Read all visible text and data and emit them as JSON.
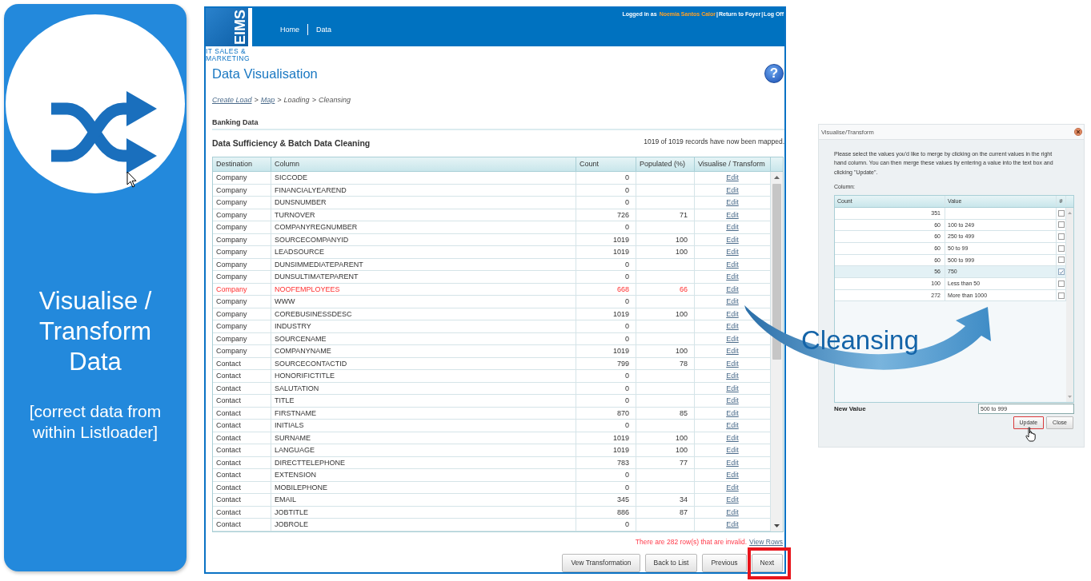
{
  "slide": {
    "title": "Visualise / Transform Data",
    "subtitle": "[correct data from within Listloader]"
  },
  "app": {
    "logo": {
      "mark": "EIMS",
      "tagline": "IT SALES & MARKETING"
    },
    "nav": [
      {
        "label": "Home"
      },
      {
        "label": "Data"
      }
    ],
    "user_bar": {
      "label": "Logged in as",
      "user": "Noemia Santos Calor",
      "separator": "|",
      "links": [
        "Return to Foyer",
        "Log Off"
      ]
    },
    "title": "Data Visualisation",
    "help": "?",
    "breadcrumb": {
      "separator": ">",
      "items": [
        {
          "label": "Create Load",
          "kind": "link"
        },
        {
          "label": "Map",
          "kind": "link"
        },
        {
          "label": "Loading",
          "kind": "text"
        },
        {
          "label": "Cleansing",
          "kind": "text"
        }
      ]
    },
    "section": "Banking Data",
    "table_title": "Data Sufficiency & Batch Data Cleaning",
    "mapped_status": "1019 of 1019 records have now been mapped.",
    "table": {
      "columns": [
        "Destination",
        "Column",
        "Count",
        "Populated (%)",
        "Visualise / Transform"
      ],
      "rows": [
        {
          "destination": "Company",
          "column": "SICCODE",
          "count": "0",
          "action": "Edit",
          "flagged": false
        },
        {
          "destination": "Company",
          "column": "FINANCIALYEAREND",
          "count": "0",
          "action": "Edit",
          "flagged": false
        },
        {
          "destination": "Company",
          "column": "DUNSNUMBER",
          "count": "0",
          "action": "Edit",
          "flagged": false
        },
        {
          "destination": "Company",
          "column": "TURNOVER",
          "count": "726",
          "populated": "71",
          "action": "Edit",
          "flagged": false
        },
        {
          "destination": "Company",
          "column": "COMPANYREGNUMBER",
          "count": "0",
          "action": "Edit",
          "flagged": false
        },
        {
          "destination": "Company",
          "column": "SOURCECOMPANYID",
          "count": "1019",
          "populated": "100",
          "action": "Edit",
          "flagged": false
        },
        {
          "destination": "Company",
          "column": "LEADSOURCE",
          "count": "1019",
          "populated": "100",
          "action": "Edit",
          "flagged": false
        },
        {
          "destination": "Company",
          "column": "DUNSIMMEDIATEPARENT",
          "count": "0",
          "action": "Edit",
          "flagged": false
        },
        {
          "destination": "Company",
          "column": "DUNSULTIMATEPARENT",
          "count": "0",
          "action": "Edit",
          "flagged": false
        },
        {
          "destination": "Company",
          "column": "NOOFEMPLOYEES",
          "count": "668",
          "populated": "66",
          "action": "Edit",
          "flagged": true
        },
        {
          "destination": "Company",
          "column": "WWW",
          "count": "0",
          "action": "Edit",
          "flagged": false
        },
        {
          "destination": "Company",
          "column": "COREBUSINESSDESC",
          "count": "1019",
          "populated": "100",
          "action": "Edit",
          "flagged": false
        },
        {
          "destination": "Company",
          "column": "INDUSTRY",
          "count": "0",
          "action": "Edit",
          "flagged": false
        },
        {
          "destination": "Company",
          "column": "SOURCENAME",
          "count": "0",
          "action": "Edit",
          "flagged": false
        },
        {
          "destination": "Company",
          "column": "COMPANYNAME",
          "count": "1019",
          "populated": "100",
          "action": "Edit",
          "flagged": false
        },
        {
          "destination": "Contact",
          "column": "SOURCECONTACTID",
          "count": "799",
          "populated": "78",
          "action": "Edit",
          "flagged": false
        },
        {
          "destination": "Contact",
          "column": "HONORIFICTITLE",
          "count": "0",
          "action": "Edit",
          "flagged": false
        },
        {
          "destination": "Contact",
          "column": "SALUTATION",
          "count": "0",
          "action": "Edit",
          "flagged": false
        },
        {
          "destination": "Contact",
          "column": "TITLE",
          "count": "0",
          "action": "Edit",
          "flagged": false
        },
        {
          "destination": "Contact",
          "column": "FIRSTNAME",
          "count": "870",
          "populated": "85",
          "action": "Edit",
          "flagged": false
        },
        {
          "destination": "Contact",
          "column": "INITIALS",
          "count": "0",
          "action": "Edit",
          "flagged": false
        },
        {
          "destination": "Contact",
          "column": "SURNAME",
          "count": "1019",
          "populated": "100",
          "action": "Edit",
          "flagged": false
        },
        {
          "destination": "Contact",
          "column": "LANGUAGE",
          "count": "1019",
          "populated": "100",
          "action": "Edit",
          "flagged": false
        },
        {
          "destination": "Contact",
          "column": "DIRECTTELEPHONE",
          "count": "783",
          "populated": "77",
          "action": "Edit",
          "flagged": false
        },
        {
          "destination": "Contact",
          "column": "EXTENSION",
          "count": "0",
          "action": "Edit",
          "flagged": false
        },
        {
          "destination": "Contact",
          "column": "MOBILEPHONE",
          "count": "0",
          "action": "Edit",
          "flagged": false
        },
        {
          "destination": "Contact",
          "column": "EMAIL",
          "count": "345",
          "populated": "34",
          "action": "Edit",
          "flagged": false
        },
        {
          "destination": "Contact",
          "column": "JOBTITLE",
          "count": "886",
          "populated": "87",
          "action": "Edit",
          "flagged": false
        },
        {
          "destination": "Contact",
          "column": "JOBROLE",
          "count": "0",
          "action": "Edit",
          "flagged": false
        }
      ]
    },
    "footer": {
      "message": "There are 282 row(s) that are invalid.",
      "link": "View Rows",
      "buttons": [
        {
          "label": "Vew Transformation",
          "highlighted": false
        },
        {
          "label": "Back to List",
          "highlighted": false
        },
        {
          "label": "Previous",
          "highlighted": false
        },
        {
          "label": "Next",
          "highlighted": true
        }
      ]
    }
  },
  "dialog": {
    "title": "Visualise/Transform",
    "instructions": "Please select the values you'd like to merge by clicking on the current values in the right hand column. You can then merge these values by entering a value into the text box and clicking \"Update\".",
    "column_label": "Column:",
    "columns": [
      "Count",
      "Value",
      "#"
    ],
    "rows": [
      {
        "count": "351",
        "checked": false
      },
      {
        "count": "60",
        "value": "100 to 249",
        "checked": false
      },
      {
        "count": "60",
        "value": "250 to 499",
        "checked": false
      },
      {
        "count": "60",
        "value": "50 to 99",
        "checked": false
      },
      {
        "count": "60",
        "value": "500 to 999",
        "checked": false
      },
      {
        "count": "56",
        "value": "750",
        "checked": true
      },
      {
        "count": "100",
        "value": "Less than 50",
        "checked": false
      },
      {
        "count": "272",
        "value": "More than 1000",
        "checked": false
      }
    ],
    "new_value_label": "New Value",
    "new_value": "500 to 999",
    "buttons": [
      {
        "label": "Update",
        "highlighted": true
      },
      {
        "label": "Close",
        "highlighted": false
      }
    ]
  },
  "callout": {
    "label": "Cleansing"
  }
}
